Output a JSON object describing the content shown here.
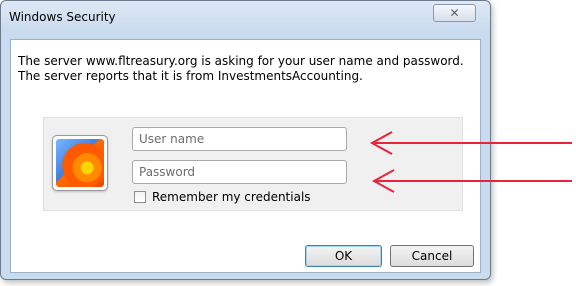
{
  "window": {
    "title": "Windows Security",
    "close_glyph": "✕"
  },
  "message": {
    "line1": "The server www.fltreasury.org is asking for your user name and password.",
    "line2": "The server reports that it is from InvestmentsAccounting."
  },
  "credentials": {
    "username_placeholder": "User name",
    "username_value": "",
    "password_placeholder": "Password",
    "password_value": "",
    "remember_label": "Remember my credentials",
    "remember_checked": false,
    "user_tile_icon": "user-tile-flower-icon"
  },
  "buttons": {
    "ok_label": "OK",
    "cancel_label": "Cancel"
  },
  "annotations": {
    "arrow_color": "#e8243c",
    "arrow_icon": "left-arrow-icon"
  },
  "colors": {
    "frame": "#c9dbef",
    "panel": "#f0f0f0"
  }
}
